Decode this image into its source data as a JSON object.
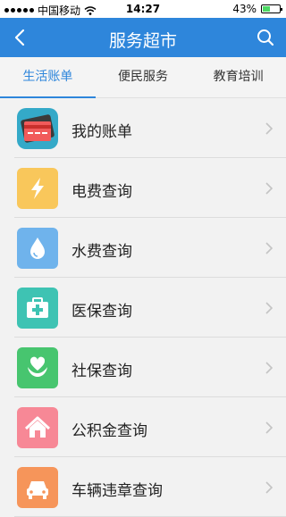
{
  "status_bar": {
    "carrier": "中国移动",
    "time": "14:27",
    "battery": "43%",
    "battery_level": 0.43
  },
  "navbar": {
    "title": "服务超市",
    "back_icon": "chevron-left-icon",
    "search_icon": "search-icon"
  },
  "tabs": [
    {
      "label": "生活账单",
      "active": true
    },
    {
      "label": "便民服务",
      "active": false
    },
    {
      "label": "教育培训",
      "active": false
    }
  ],
  "items": [
    {
      "label": "我的账单",
      "icon": "bill-card-icon",
      "color": "#34a9c8"
    },
    {
      "label": "电费查询",
      "icon": "lightning-icon",
      "color": "#f9c75b"
    },
    {
      "label": "水费查询",
      "icon": "water-drop-icon",
      "color": "#6fb3ec"
    },
    {
      "label": "医保查询",
      "icon": "medical-kit-icon",
      "color": "#3ec3b3"
    },
    {
      "label": "社保查询",
      "icon": "heart-hands-icon",
      "color": "#47c56f"
    },
    {
      "label": "公积金查询",
      "icon": "house-icon",
      "color": "#f78896"
    },
    {
      "label": "车辆违章查询",
      "icon": "car-icon",
      "color": "#f6955a"
    }
  ]
}
